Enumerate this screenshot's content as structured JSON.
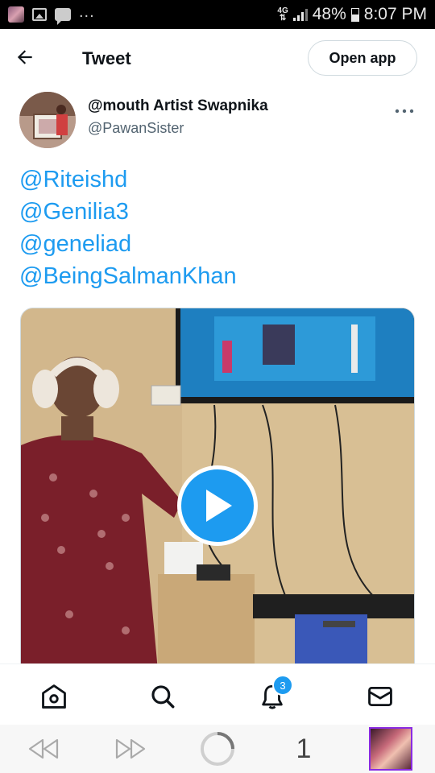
{
  "status_bar": {
    "network": "4G",
    "battery": "48%",
    "time": "8:07 PM",
    "overflow": "..."
  },
  "header": {
    "title": "Tweet",
    "open_app_label": "Open app"
  },
  "tweet": {
    "author_name": "@mouth Artist Swapnika",
    "author_handle": "@PawanSister",
    "mentions": [
      "@Riteishd",
      "@Genilia3",
      "@geneliad",
      "@BeingSalmanKhan"
    ]
  },
  "media": {
    "type": "video",
    "icon": "play-icon"
  },
  "bottom_nav": {
    "items": [
      {
        "name": "home",
        "icon": "home-icon"
      },
      {
        "name": "search",
        "icon": "search-icon"
      },
      {
        "name": "notifications",
        "icon": "bell-icon",
        "badge": "3"
      },
      {
        "name": "messages",
        "icon": "mail-icon"
      }
    ]
  },
  "browser_bar": {
    "tab_count": "1"
  },
  "colors": {
    "accent": "#1d9bf0",
    "text": "#0f1419",
    "secondary": "#536471"
  }
}
